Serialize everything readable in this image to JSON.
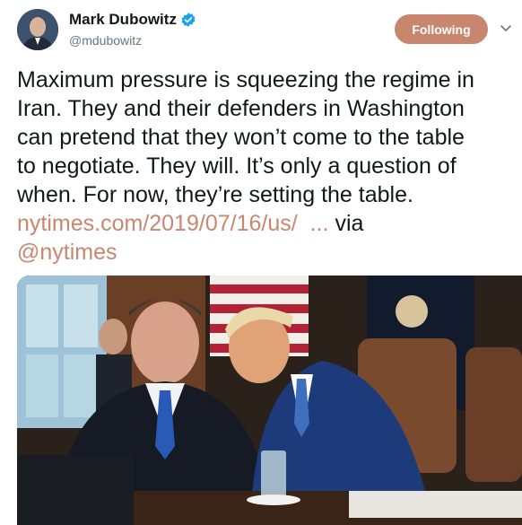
{
  "author": {
    "display_name": "Mark Dubowitz",
    "handle": "@mdubowitz",
    "verified_icon": "verified-badge-icon"
  },
  "actions": {
    "follow_label": "Following",
    "menu_icon": "chevron-down-icon"
  },
  "tweet": {
    "text": "Maximum pressure is squeezing the regime in\nIran. They and their defenders in Washington\ncan pretend that they won’t come to the table\nto negotiate. They will. It’s only a question of\nwhen. For now, they’re setting the table.",
    "link": "nytimes.com/2019/07/16/us/",
    "ellipsis": "...",
    "via": "via",
    "mention": "@nytimes"
  },
  "colors": {
    "accent": "#c9866f",
    "verified": "#1da1f2",
    "text": "#14171a",
    "muted": "#657786"
  }
}
